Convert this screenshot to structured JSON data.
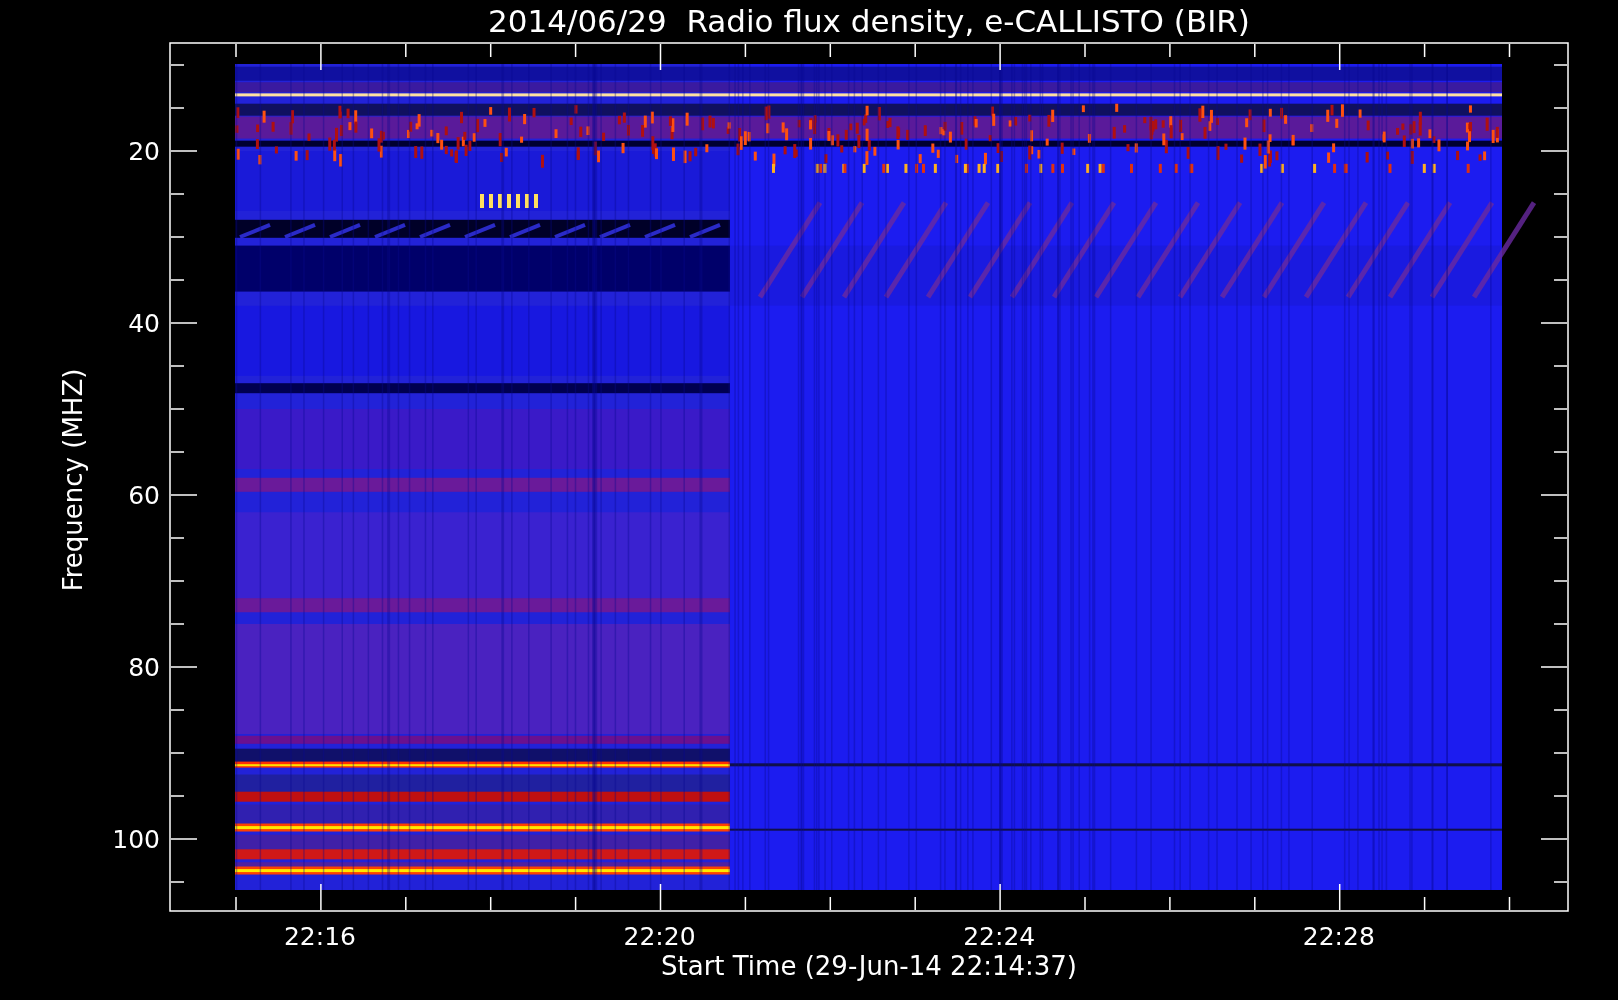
{
  "title": "2014/06/29  Radio flux density, e-CALLISTO (BIR)",
  "y_axis": {
    "label": "Frequency (MHZ)",
    "ticks": [
      "20",
      "40",
      "60",
      "80",
      "100"
    ]
  },
  "x_axis": {
    "label": "Start Time (29-Jun-14 22:14:37)",
    "ticks": [
      "22:16",
      "22:20",
      "22:24",
      "22:28"
    ]
  }
}
